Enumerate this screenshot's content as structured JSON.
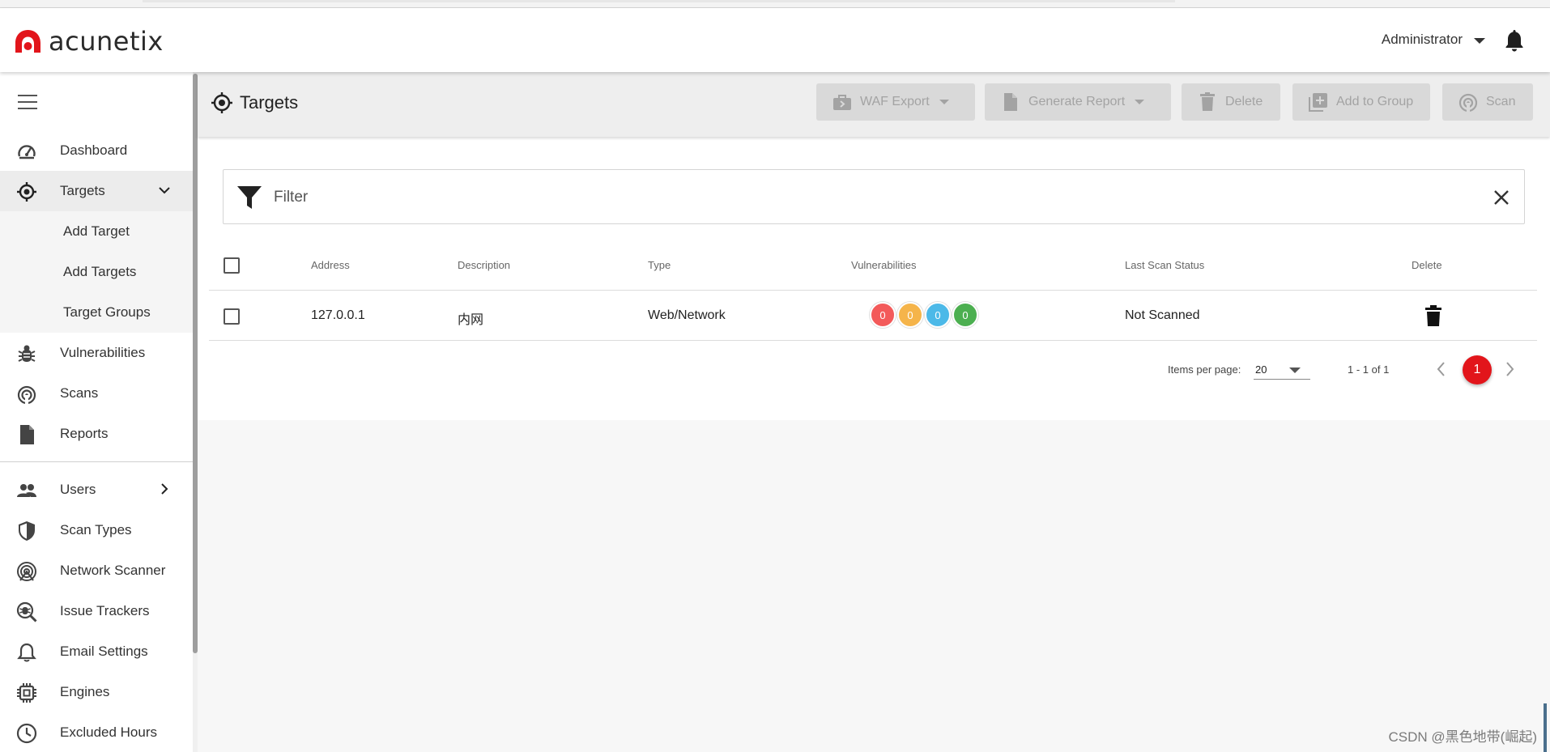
{
  "app": {
    "logo_text": "acunetix",
    "brand_color": "#e2151b"
  },
  "header": {
    "user_label": "Administrator"
  },
  "sidebar": {
    "items": [
      {
        "label": "Dashboard",
        "icon": "dashboard-icon"
      },
      {
        "label": "Targets",
        "icon": "target-icon"
      },
      {
        "label": "Add Target"
      },
      {
        "label": "Add Targets"
      },
      {
        "label": "Target Groups"
      },
      {
        "label": "Vulnerabilities",
        "icon": "bug-icon"
      },
      {
        "label": "Scans",
        "icon": "radar-icon"
      },
      {
        "label": "Reports",
        "icon": "document-icon"
      },
      {
        "label": "Users",
        "icon": "users-icon"
      },
      {
        "label": "Scan Types",
        "icon": "shield-icon"
      },
      {
        "label": "Network Scanner",
        "icon": "network-scanner-icon"
      },
      {
        "label": "Issue Trackers",
        "icon": "bug-search-icon"
      },
      {
        "label": "Email Settings",
        "icon": "bell-icon"
      },
      {
        "label": "Engines",
        "icon": "chip-icon"
      },
      {
        "label": "Excluded Hours",
        "icon": "clock-icon"
      }
    ]
  },
  "toolbar": {
    "title": "Targets",
    "waf_export": "WAF Export",
    "generate_report": "Generate Report",
    "delete": "Delete",
    "add_to_group": "Add to Group",
    "scan": "Scan"
  },
  "filter": {
    "label": "Filter"
  },
  "table": {
    "headers": {
      "address": "Address",
      "description": "Description",
      "type": "Type",
      "vulnerabilities": "Vulnerabilities",
      "last_scan_status": "Last Scan Status",
      "delete": "Delete"
    },
    "rows": [
      {
        "address": "127.0.0.1",
        "description": "内网",
        "type": "Web/Network",
        "vuln_counts": [
          "0",
          "0",
          "0",
          "0"
        ],
        "vuln_colors": [
          "#f35a5a",
          "#f5b44a",
          "#4cb9e8",
          "#4caf50"
        ],
        "last_scan_status": "Not Scanned"
      }
    ]
  },
  "pagination": {
    "items_per_page_label": "Items per page:",
    "items_per_page": "20",
    "range": "1 - 1 of 1",
    "current_page": "1"
  },
  "watermark": "CSDN @黑色地带(崛起)"
}
